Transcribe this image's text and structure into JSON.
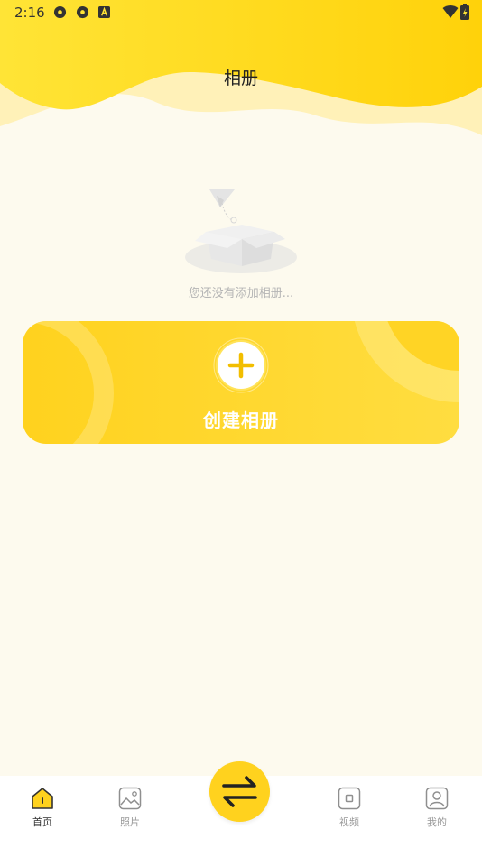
{
  "status_bar": {
    "time": "2:16"
  },
  "page": {
    "title": "相册"
  },
  "empty_state": {
    "message": "您还没有添加相册..."
  },
  "create_album": {
    "label": "创建相册"
  },
  "tab_bar": {
    "tabs": [
      {
        "label": "首页",
        "icon": "home-icon",
        "active": true
      },
      {
        "label": "照片",
        "icon": "photo-icon",
        "active": false
      },
      {
        "label": "视频",
        "icon": "video-icon",
        "active": false
      },
      {
        "label": "我的",
        "icon": "profile-icon",
        "active": false
      }
    ],
    "center_icon": "swap-arrows-icon"
  },
  "colors": {
    "accent": "#ffd21e",
    "background": "#fdfaee",
    "muted_text": "#b5b5b5"
  }
}
